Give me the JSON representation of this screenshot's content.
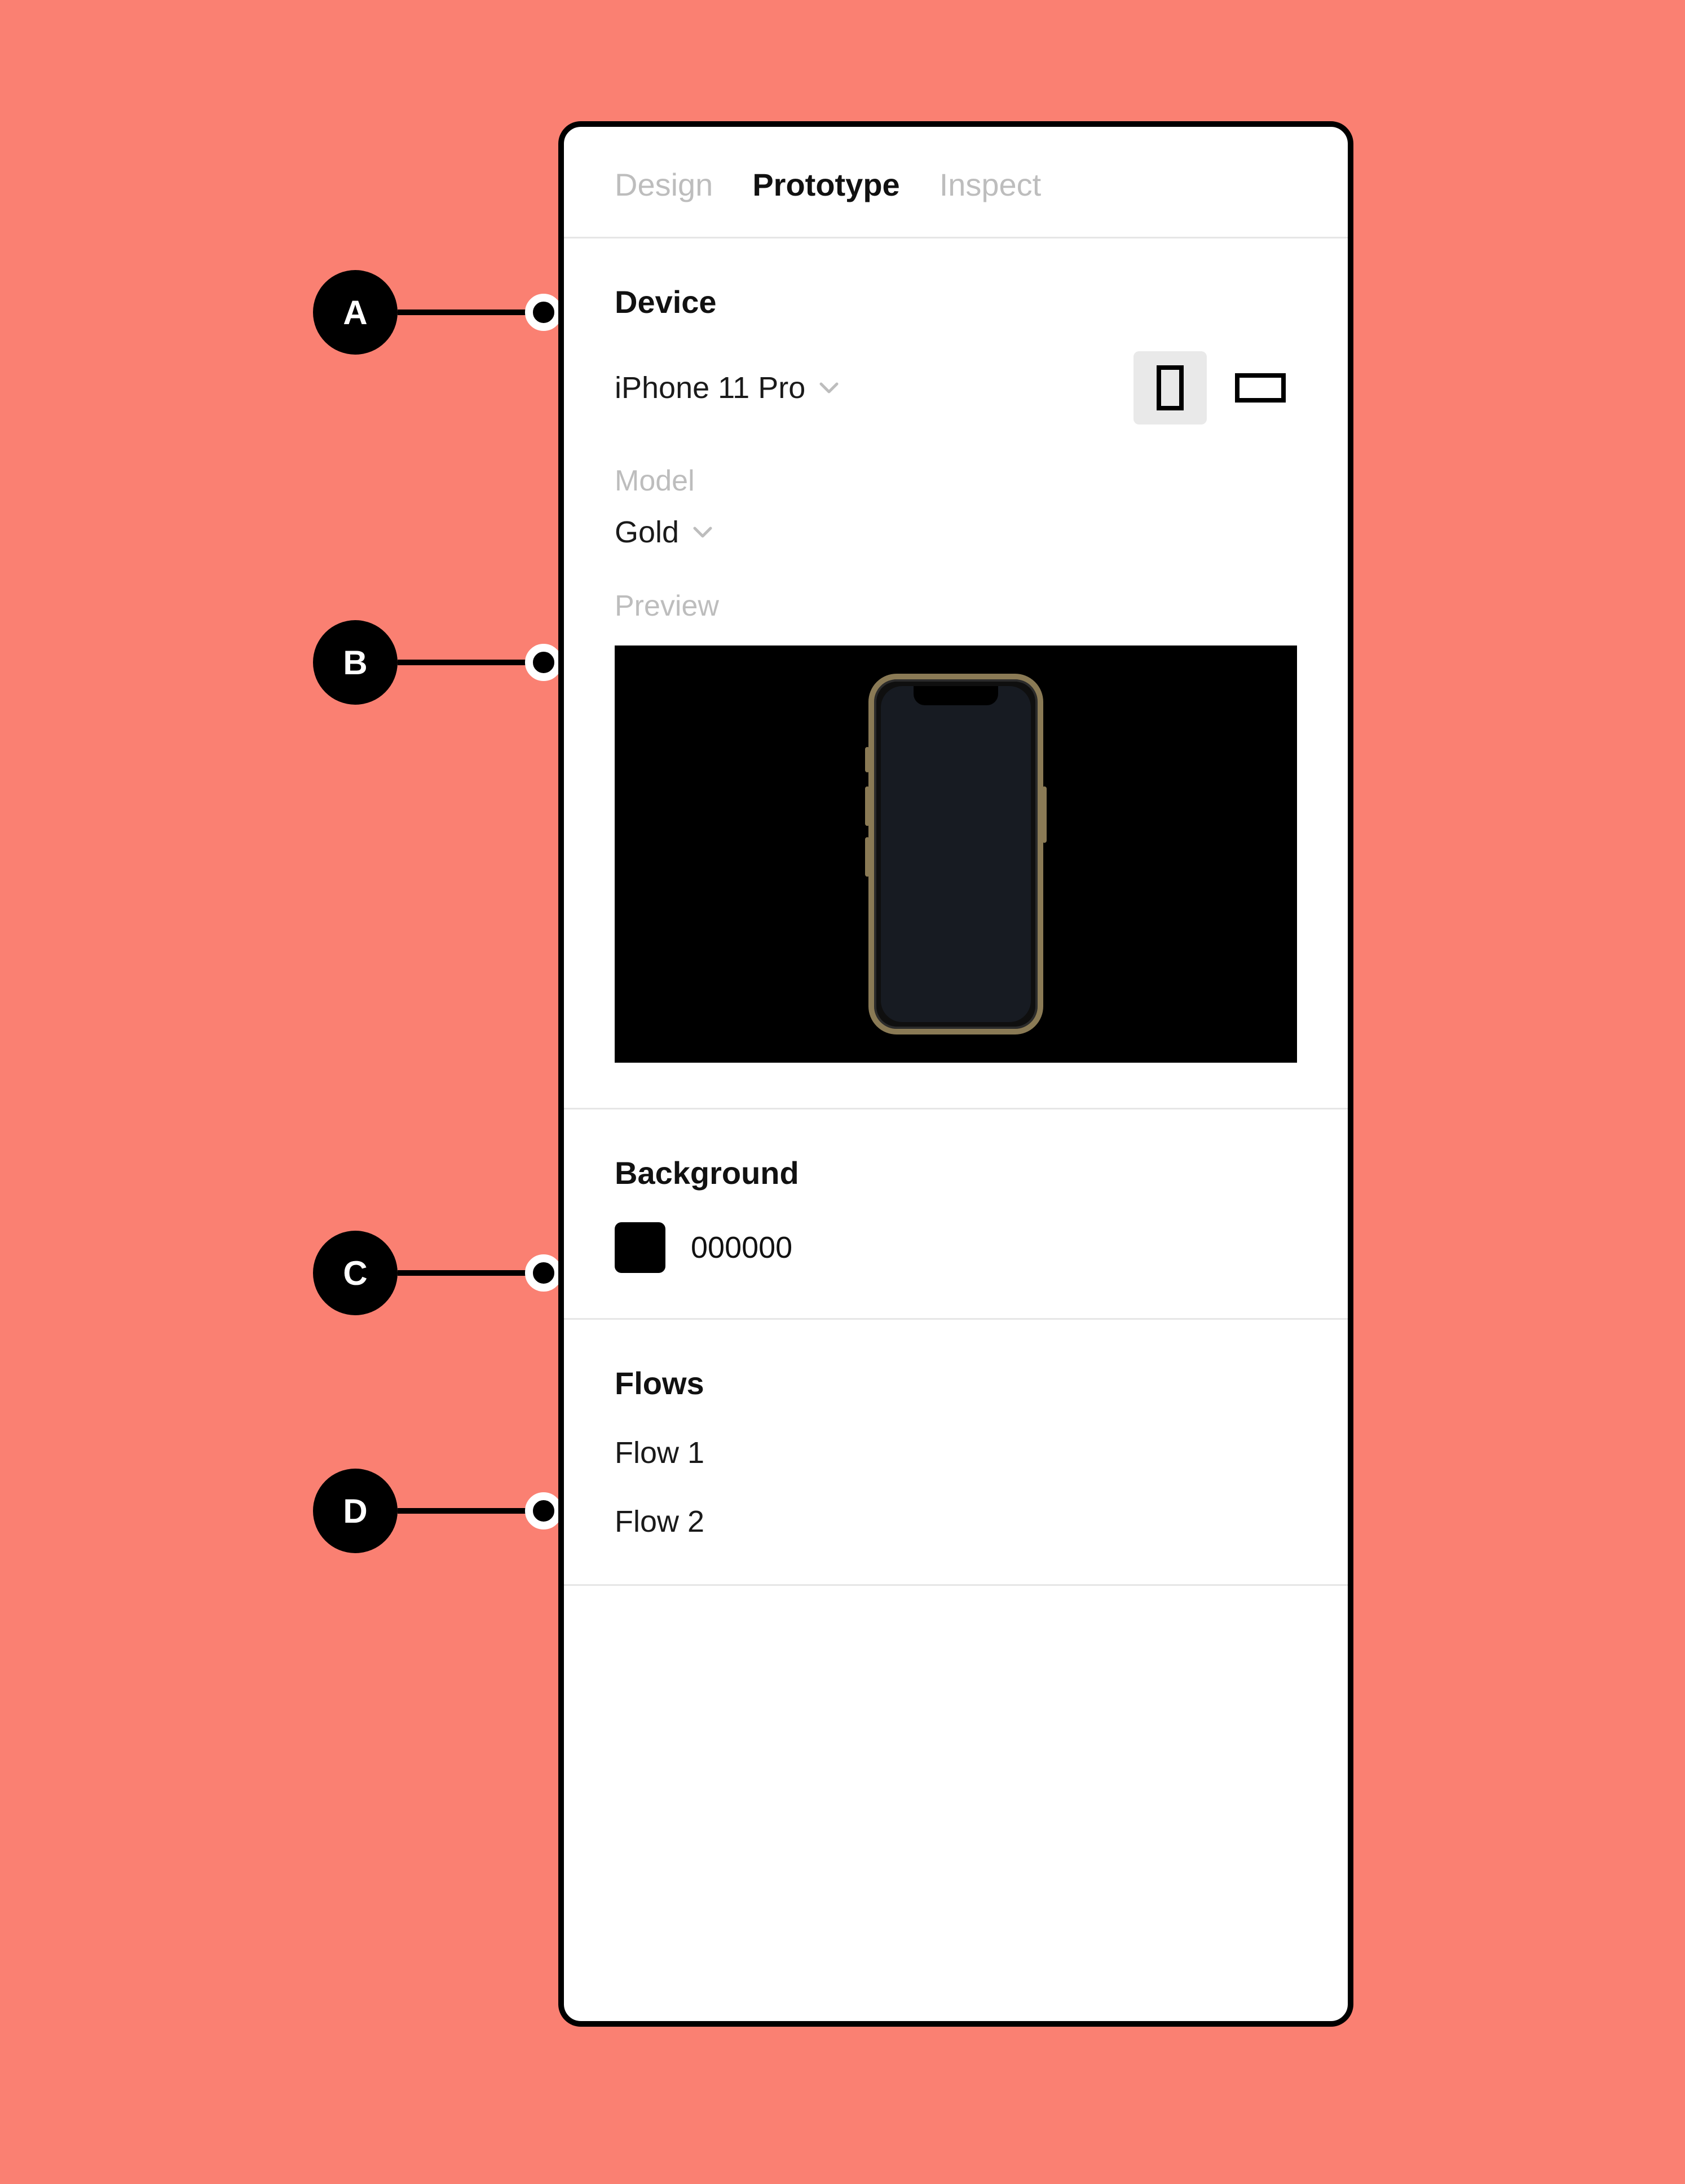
{
  "tabs": {
    "design": "Design",
    "prototype": "Prototype",
    "inspect": "Inspect"
  },
  "device": {
    "title": "Device",
    "selected": "iPhone 11 Pro",
    "model_label": "Model",
    "model_selected": "Gold",
    "preview_label": "Preview"
  },
  "background": {
    "title": "Background",
    "hex": "000000",
    "swatch_color": "#000000"
  },
  "flows": {
    "title": "Flows",
    "items": [
      "Flow 1",
      "Flow 2"
    ]
  },
  "callouts": {
    "a": "A",
    "b": "B",
    "c": "C",
    "d": "D"
  }
}
